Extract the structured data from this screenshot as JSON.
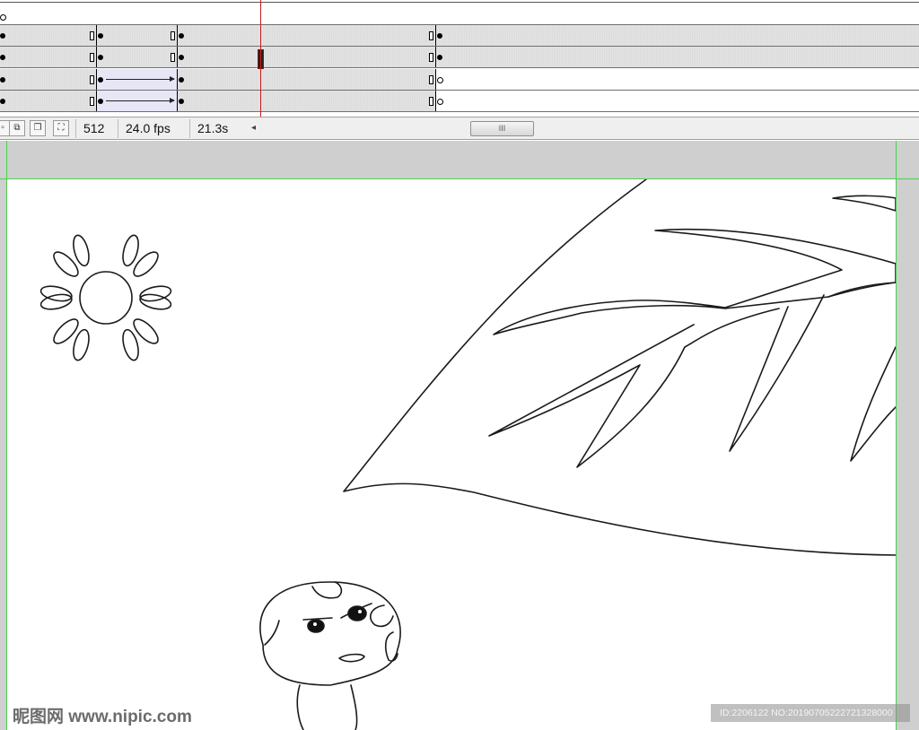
{
  "status_bar": {
    "current_frame": "512",
    "frame_rate": "24.0 fps",
    "elapsed_time": "21.3s",
    "scroll_thumb_label": "III",
    "scroll_left_arrow": "◂"
  },
  "toolbar_icons": [
    "onion-skin-icon",
    "onion-skin-outline-icon",
    "edit-multiple-frames-icon",
    "modify-markers-icon"
  ],
  "colors": {
    "playhead": "#c02020",
    "guide": "#4bd14b",
    "pasteboard": "#cfcfcf",
    "stage": "#ffffff"
  },
  "watermark": {
    "site": "昵图网 www.nipic.com",
    "id_text": "ID:2206122 NO:20190705222721328000"
  }
}
